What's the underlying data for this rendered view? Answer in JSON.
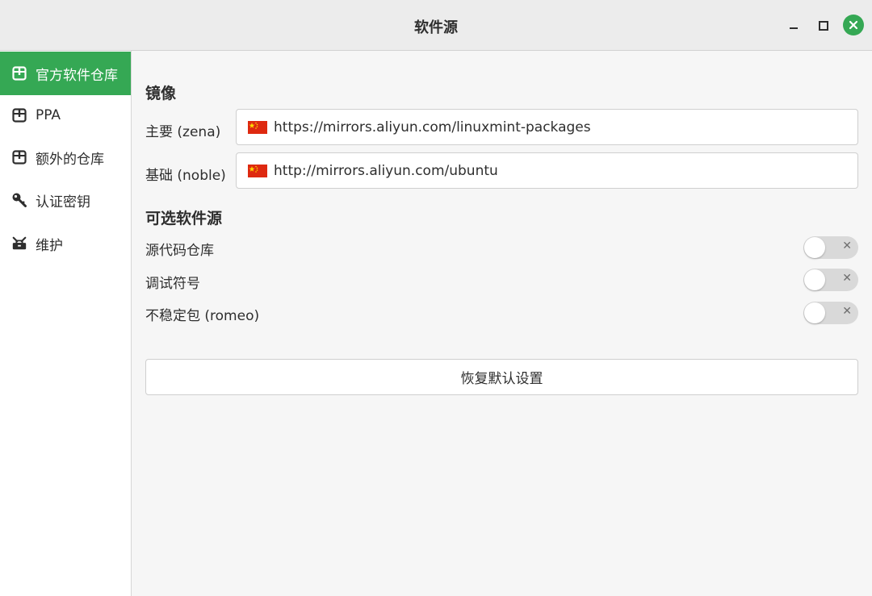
{
  "window": {
    "title": "软件源"
  },
  "sidebar": {
    "items": [
      {
        "label": "官方软件仓库",
        "icon": "package-icon",
        "active": true
      },
      {
        "label": "PPA",
        "icon": "package-icon",
        "active": false
      },
      {
        "label": "额外的仓库",
        "icon": "package-icon",
        "active": false
      },
      {
        "label": "认证密钥",
        "icon": "key-icon",
        "active": false
      },
      {
        "label": "维护",
        "icon": "tools-icon",
        "active": false
      }
    ]
  },
  "mirrors": {
    "title": "镜像",
    "main_label": "主要 (zena)",
    "main_url": "https://mirrors.aliyun.com/linuxmint-packages",
    "base_label": "基础 (noble)",
    "base_url": "http://mirrors.aliyun.com/ubuntu"
  },
  "optional": {
    "title": "可选软件源",
    "items": [
      {
        "label": "源代码仓库",
        "enabled": false
      },
      {
        "label": "调试符号",
        "enabled": false
      },
      {
        "label": "不稳定包 (romeo)",
        "enabled": false
      }
    ]
  },
  "actions": {
    "reset_label": "恢复默认设置"
  },
  "colors": {
    "accent": "#35a854",
    "flag": "#de2910"
  }
}
